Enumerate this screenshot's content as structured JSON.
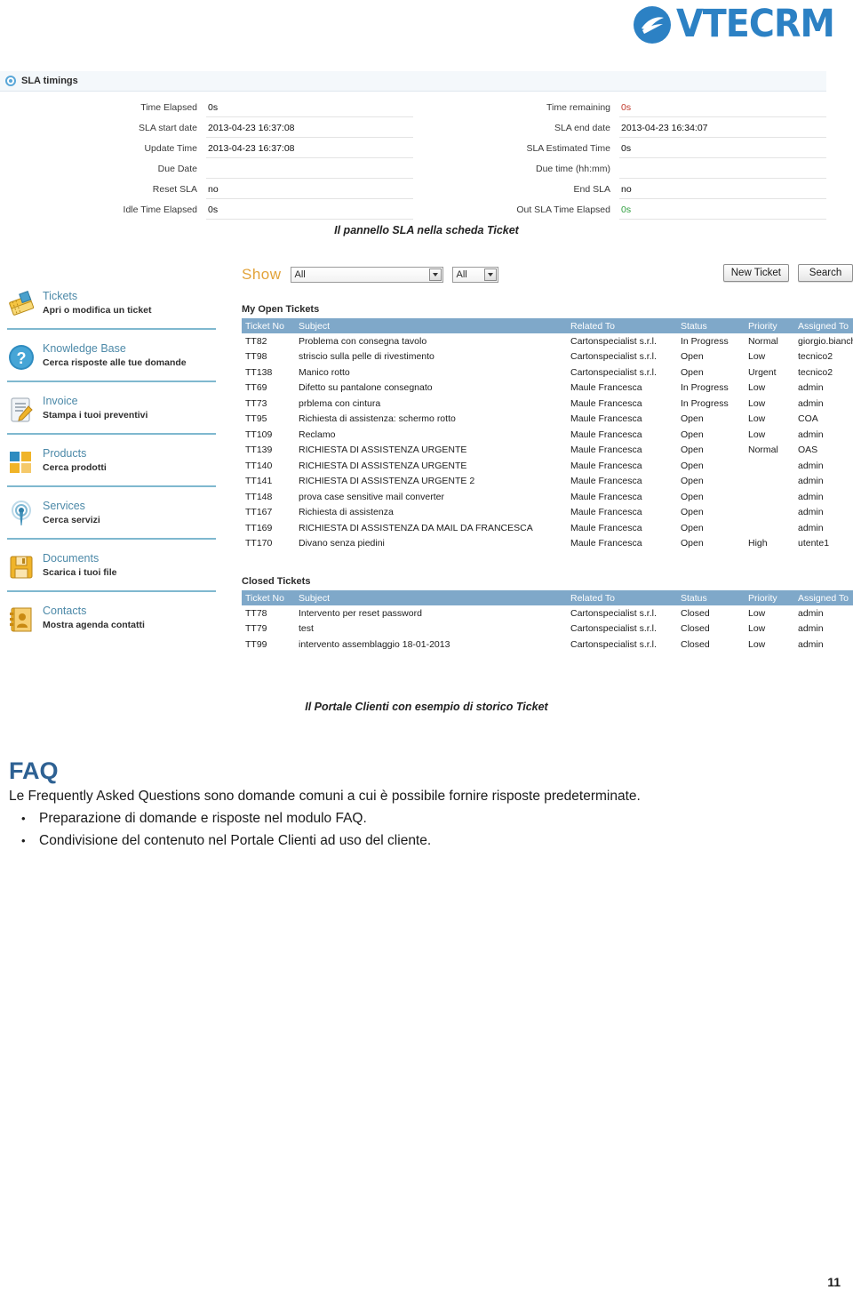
{
  "brand": {
    "logo_text": "VTECRM",
    "logo_color": "#2c81c4"
  },
  "sla_panel": {
    "header_title": "SLA timings",
    "left_rows": [
      {
        "label": "Time Elapsed",
        "value": "0s",
        "tone": "normal"
      },
      {
        "label": "SLA start date",
        "value": "2013-04-23 16:37:08",
        "tone": "normal"
      },
      {
        "label": "Update Time",
        "value": "2013-04-23 16:37:08",
        "tone": "normal"
      },
      {
        "label": "Due Date",
        "value": "",
        "tone": "normal"
      },
      {
        "label": "Reset SLA",
        "value": "no",
        "tone": "normal"
      },
      {
        "label": "Idle Time Elapsed",
        "value": "0s",
        "tone": "normal"
      }
    ],
    "right_rows": [
      {
        "label": "Time remaining",
        "value": "0s",
        "tone": "red"
      },
      {
        "label": "SLA end date",
        "value": "2013-04-23 16:34:07",
        "tone": "normal"
      },
      {
        "label": "SLA Estimated Time",
        "value": "0s",
        "tone": "normal"
      },
      {
        "label": "Due time (hh:mm)",
        "value": "",
        "tone": "normal"
      },
      {
        "label": "End SLA",
        "value": "no",
        "tone": "normal"
      },
      {
        "label": "Out SLA Time Elapsed",
        "value": "0s",
        "tone": "green"
      }
    ]
  },
  "captions": {
    "sla": "Il pannello SLA nella scheda Ticket",
    "portal": "Il Portale Clienti con esempio di storico Ticket"
  },
  "sidebar": {
    "items": [
      {
        "icon": "tickets-icon",
        "title": "Tickets",
        "subtitle": "Apri o modifica un ticket"
      },
      {
        "icon": "question-mark-icon",
        "title": "Knowledge Base",
        "subtitle": "Cerca risposte alle tue domande"
      },
      {
        "icon": "invoice-icon",
        "title": "Invoice",
        "subtitle": "Stampa i tuoi preventivi"
      },
      {
        "icon": "products-icon",
        "title": "Products",
        "subtitle": "Cerca prodotti"
      },
      {
        "icon": "services-icon",
        "title": "Services",
        "subtitle": "Cerca servizi"
      },
      {
        "icon": "floppy-disk-icon",
        "title": "Documents",
        "subtitle": "Scarica i tuoi file"
      },
      {
        "icon": "contacts-book-icon",
        "title": "Contacts",
        "subtitle": "Mostra agenda contatti"
      }
    ]
  },
  "portal": {
    "show_label": "Show",
    "filter_category": "All",
    "filter_status": "All",
    "new_ticket_label": "New Ticket",
    "search_label": "Search",
    "open_list_title": "My Open Tickets",
    "closed_list_title": "Closed Tickets",
    "columns": [
      "Ticket No",
      "Subject",
      "Related To",
      "Status",
      "Priority",
      "Assigned To"
    ],
    "open_tickets": [
      {
        "no": "TT82",
        "subject": "Problema con consegna tavolo",
        "related": "Cartonspecialist s.r.l.",
        "status": "In Progress",
        "priority": "Normal",
        "assigned": "giorgio.bianchi"
      },
      {
        "no": "TT98",
        "subject": "striscio sulla pelle di rivestimento",
        "related": "Cartonspecialist s.r.l.",
        "status": "Open",
        "priority": "Low",
        "assigned": "tecnico2"
      },
      {
        "no": "TT138",
        "subject": "Manico rotto",
        "related": "Cartonspecialist s.r.l.",
        "status": "Open",
        "priority": "Urgent",
        "assigned": "tecnico2"
      },
      {
        "no": "TT69",
        "subject": "Difetto su pantalone consegnato",
        "related": "Maule Francesca",
        "status": "In Progress",
        "priority": "Low",
        "assigned": "admin"
      },
      {
        "no": "TT73",
        "subject": "prblema con cintura",
        "related": "Maule Francesca",
        "status": "In Progress",
        "priority": "Low",
        "assigned": "admin"
      },
      {
        "no": "TT95",
        "subject": "Richiesta di assistenza: schermo rotto",
        "related": "Maule Francesca",
        "status": "Open",
        "priority": "Low",
        "assigned": "COA"
      },
      {
        "no": "TT109",
        "subject": "Reclamo",
        "related": "Maule Francesca",
        "status": "Open",
        "priority": "Low",
        "assigned": "admin"
      },
      {
        "no": "TT139",
        "subject": "RICHIESTA DI ASSISTENZA URGENTE",
        "related": "Maule Francesca",
        "status": "Open",
        "priority": "Normal",
        "assigned": "OAS"
      },
      {
        "no": "TT140",
        "subject": "RICHIESTA DI ASSISTENZA URGENTE",
        "related": "Maule Francesca",
        "status": "Open",
        "priority": "",
        "assigned": "admin"
      },
      {
        "no": "TT141",
        "subject": "RICHIESTA DI ASSISTENZA URGENTE 2",
        "related": "Maule Francesca",
        "status": "Open",
        "priority": "",
        "assigned": "admin"
      },
      {
        "no": "TT148",
        "subject": "prova case sensitive mail converter",
        "related": "Maule Francesca",
        "status": "Open",
        "priority": "",
        "assigned": "admin"
      },
      {
        "no": "TT167",
        "subject": "Richiesta di assistenza",
        "related": "Maule Francesca",
        "status": "Open",
        "priority": "",
        "assigned": "admin"
      },
      {
        "no": "TT169",
        "subject": "RICHIESTA DI ASSISTENZA DA MAIL DA FRANCESCA",
        "related": "Maule Francesca",
        "status": "Open",
        "priority": "",
        "assigned": "admin"
      },
      {
        "no": "TT170",
        "subject": "Divano senza piedini",
        "related": "Maule Francesca",
        "status": "Open",
        "priority": "High",
        "assigned": "utente1"
      }
    ],
    "closed_tickets": [
      {
        "no": "TT78",
        "subject": "Intervento per reset password",
        "related": "Cartonspecialist s.r.l.",
        "status": "Closed",
        "priority": "Low",
        "assigned": "admin"
      },
      {
        "no": "TT79",
        "subject": "test",
        "related": "Cartonspecialist s.r.l.",
        "status": "Closed",
        "priority": "Low",
        "assigned": "admin"
      },
      {
        "no": "TT99",
        "subject": "intervento assemblaggio 18-01-2013",
        "related": "Cartonspecialist s.r.l.",
        "status": "Closed",
        "priority": "Low",
        "assigned": "admin"
      }
    ]
  },
  "faq": {
    "heading": "FAQ",
    "paragraph": "Le Frequently Asked Questions sono domande comuni a cui è possibile fornire risposte predeterminate.",
    "bullets": [
      "Preparazione di domande e risposte nel modulo FAQ.",
      "Condivisione del contenuto nel Portale Clienti ad uso del cliente."
    ]
  },
  "page_number": "11"
}
